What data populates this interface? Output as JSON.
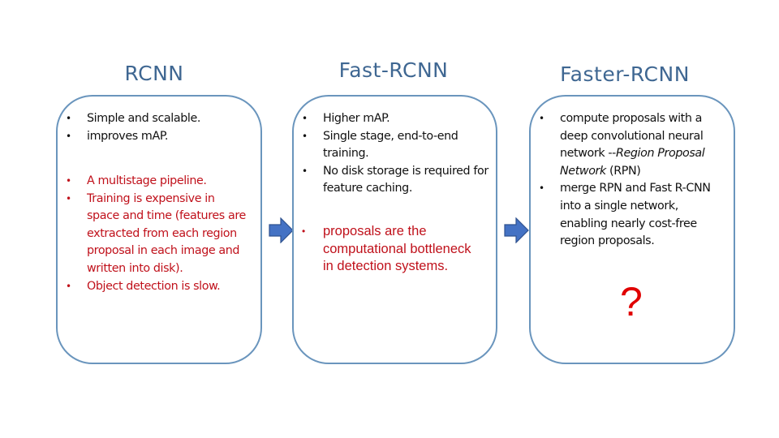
{
  "columns": [
    {
      "title": "RCNN",
      "groups": [
        {
          "tone": "black",
          "items": [
            "Simple and scalable.",
            "improves mAP."
          ]
        },
        {
          "tone": "red",
          "items": [
            "A multistage pipeline.",
            "Training is expensive in space and time (features are extracted from each region proposal in each image and written into disk).",
            "Object detection is slow."
          ]
        }
      ]
    },
    {
      "title": "Fast-RCNN",
      "groups": [
        {
          "tone": "black",
          "items": [
            "Higher mAP.",
            "Single stage, end-to-end training.",
            "No disk storage is required for feature caching."
          ]
        },
        {
          "tone": "red",
          "items": [
            "proposals are the computational bottleneck in detection systems."
          ]
        }
      ]
    },
    {
      "title": "Faster-RCNN",
      "groups": [
        {
          "tone": "black",
          "items": [
            {
              "pre": "compute proposals with a deep convolutional neural network --",
              "italic": "Region Proposal Network",
              "post": " (RPN)"
            },
            "merge RPN and Fast R-CNN into a single network, enabling nearly cost-free region proposals."
          ]
        }
      ],
      "mark": "?"
    }
  ],
  "arrows": [
    {
      "from": "RCNN",
      "to": "Fast-RCNN",
      "icon": "right-arrow-icon"
    },
    {
      "from": "Fast-RCNN",
      "to": "Faster-RCNN",
      "icon": "right-arrow-icon"
    }
  ],
  "colors": {
    "title": "#3f6792",
    "border": "#6a95bd",
    "red_text": "#c0111b",
    "arrow_fill": "#4472c4",
    "question": "#e00000"
  }
}
